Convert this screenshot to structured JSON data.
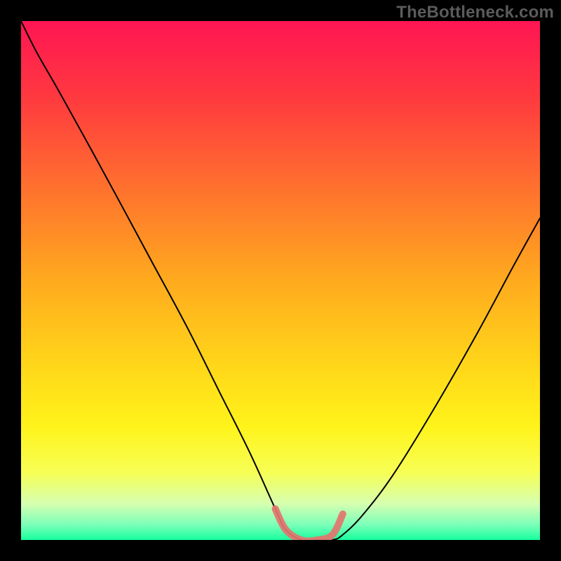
{
  "watermark": "TheBottleneck.com",
  "chart_data": {
    "type": "line",
    "title": "",
    "xlabel": "",
    "ylabel": "",
    "xlim": [
      0,
      100
    ],
    "ylim": [
      0,
      100
    ],
    "background_gradient": {
      "stops": [
        {
          "offset": 0.0,
          "color": "#ff1553"
        },
        {
          "offset": 0.15,
          "color": "#ff3a3f"
        },
        {
          "offset": 0.35,
          "color": "#ff7a2b"
        },
        {
          "offset": 0.5,
          "color": "#ffaa1e"
        },
        {
          "offset": 0.65,
          "color": "#ffd31a"
        },
        {
          "offset": 0.78,
          "color": "#fff31a"
        },
        {
          "offset": 0.87,
          "color": "#f7ff55"
        },
        {
          "offset": 0.93,
          "color": "#d6ffb0"
        },
        {
          "offset": 0.97,
          "color": "#7dffb8"
        },
        {
          "offset": 1.0,
          "color": "#17ff9e"
        }
      ]
    },
    "series": [
      {
        "name": "bottleneck-curve",
        "color": "#000000",
        "width": 2,
        "x": [
          0,
          3,
          7,
          12,
          18,
          25,
          32,
          38,
          44,
          49,
          51,
          54,
          57,
          60,
          62,
          66,
          72,
          80,
          88,
          95,
          100
        ],
        "y": [
          100,
          94,
          87,
          78,
          67,
          54,
          41,
          29,
          17,
          6,
          2,
          0,
          0,
          0,
          1,
          5,
          13,
          26,
          40,
          53,
          62
        ]
      },
      {
        "name": "trough-highlight",
        "color": "#e4746e",
        "width": 10,
        "x": [
          49,
          51,
          54,
          57,
          60,
          62
        ],
        "y": [
          6,
          2,
          0,
          0,
          1,
          5
        ]
      }
    ]
  }
}
